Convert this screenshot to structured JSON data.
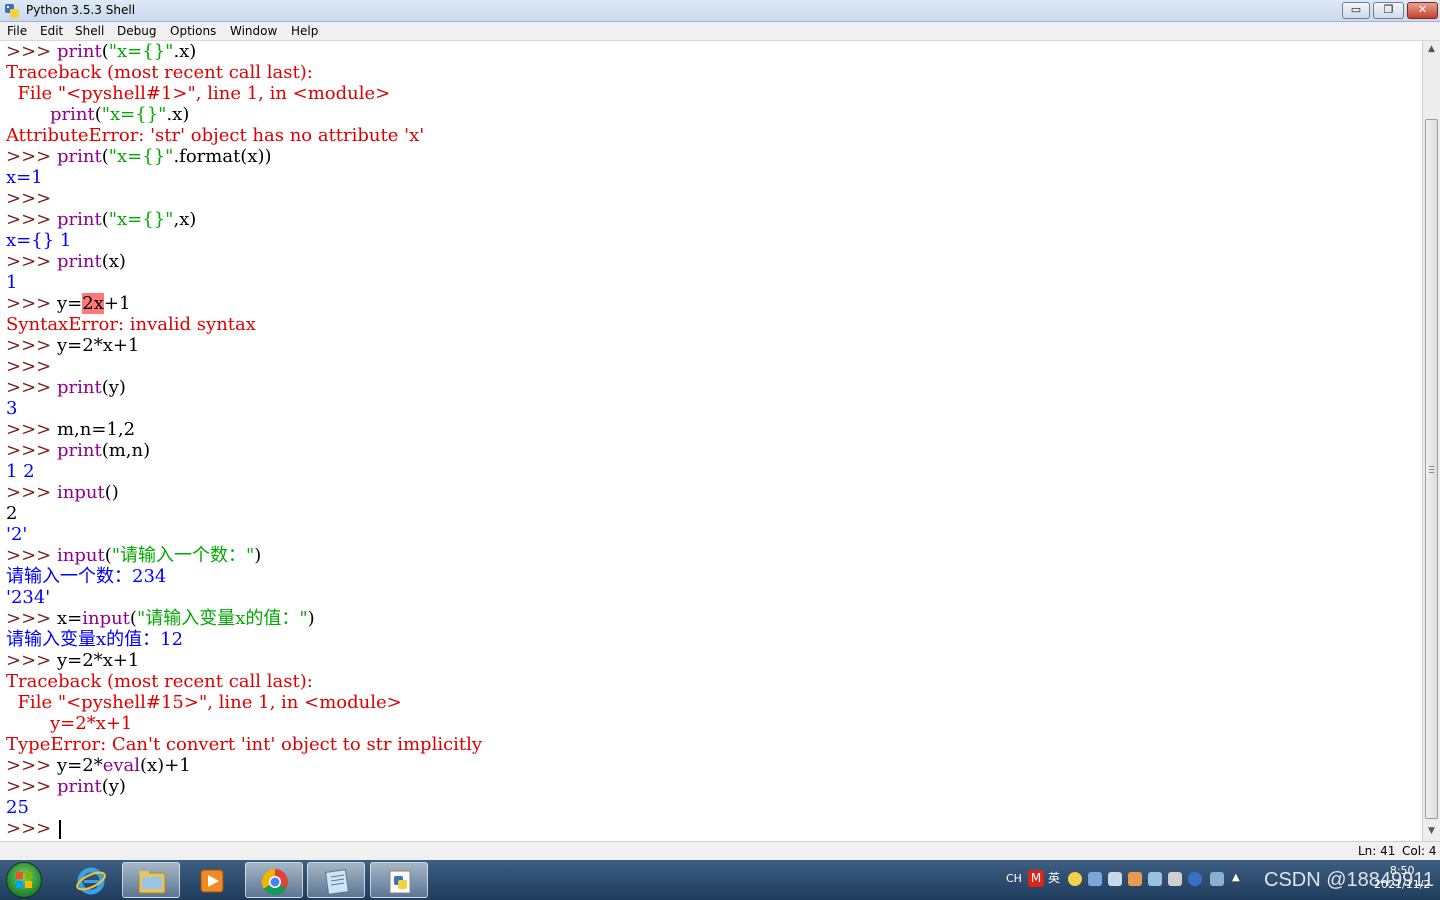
{
  "window": {
    "title": "Python 3.5.3 Shell",
    "minimize_label": "▭",
    "maximize_label": "❐",
    "close_label": "✕"
  },
  "menu": {
    "file": "File",
    "edit": "Edit",
    "shell": "Shell",
    "debug": "Debug",
    "options": "Options",
    "window": "Window",
    "help": "Help"
  },
  "shell": {
    "prompt": ">>>",
    "l1_a": "print",
    "l1_b": "(",
    "l1_c": "\"x={}\"",
    "l1_d": ".x)",
    "l2": "Traceback (most recent call last):",
    "l3": "  File \"<pyshell#1>\", line 1, in <module>",
    "l4_a": "print",
    "l4_b": "(",
    "l4_c": "\"x={}\"",
    "l4_d": ".x)",
    "l5": "AttributeError: 'str' object has no attribute 'x'",
    "l6_a": "print",
    "l6_b": "(",
    "l6_c": "\"x={}\"",
    "l6_d": ".format(x))",
    "l7": "x=1",
    "l9_a": "print",
    "l9_b": "(",
    "l9_c": "\"x={}\"",
    "l9_d": ",x)",
    "l10": "x={} 1",
    "l11_a": "print",
    "l11_b": "(x)",
    "l12": "1",
    "l13_a": "y=",
    "l13_b": "2x",
    "l13_c": "+1",
    "l14": "SyntaxError: invalid syntax",
    "l15": "y=2*x+1",
    "l17_a": "print",
    "l17_b": "(y)",
    "l18": "3",
    "l19": "m,n=1,2",
    "l20_a": "print",
    "l20_b": "(m,n)",
    "l21": "1 2",
    "l22_a": "input",
    "l22_b": "()",
    "l23": "2",
    "l24": "'2'",
    "l25_a": "input",
    "l25_b": "(",
    "l25_c": "\"请输入一个数：\"",
    "l25_d": ")",
    "l26": "请输入一个数：234",
    "l27": "'234'",
    "l28_a": "x=",
    "l28_b": "input",
    "l28_c": "(",
    "l28_d": "\"请输入变量x的值：\"",
    "l28_e": ")",
    "l29": "请输入变量x的值：12",
    "l30": "y=2*x+1",
    "l31": "Traceback (most recent call last):",
    "l32": "  File \"<pyshell#15>\", line 1, in <module>",
    "l33": "y=2*x+1",
    "l34": "TypeError: Can't convert 'int' object to str implicitly",
    "l35_a": "y=2*",
    "l35_b": "eval",
    "l35_c": "(x)+1",
    "l36_a": "print",
    "l36_b": "(y)",
    "l37": "25"
  },
  "status": {
    "ln": "Ln: 41",
    "col": "Col: 4"
  },
  "tray": {
    "lang": "CH",
    "ime_m": "M",
    "ime_en": "英",
    "watermark": "CSDN @18849911",
    "time": "8:50",
    "date": "2021/11/2"
  },
  "colors": {
    "keyword": "#9900ff",
    "builtin": "#900090",
    "string": "#00aa00",
    "error": "#dd0000",
    "output": "#0000ff",
    "prompt": "#7a1a1a"
  },
  "icons": [
    "python-idle-icon",
    "windows-start-icon",
    "ie-icon",
    "file-explorer-icon",
    "media-player-icon",
    "chrome-icon",
    "notepad-icon",
    "python-icon"
  ]
}
